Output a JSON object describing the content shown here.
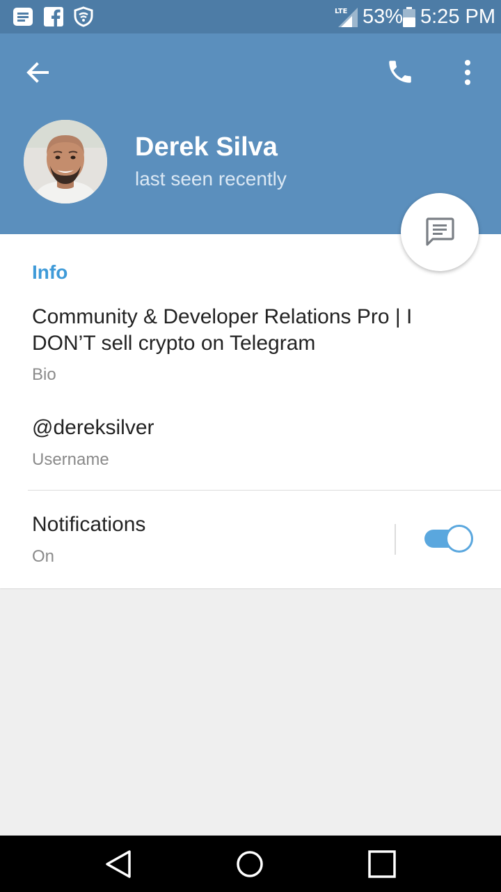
{
  "status_bar": {
    "icons": [
      "notes-icon",
      "facebook-icon",
      "vpn-shield-icon",
      "lte-signal-icon",
      "battery-icon"
    ],
    "network": "LTE",
    "battery": "53%",
    "time": "5:25 PM"
  },
  "header": {
    "back_icon": "arrow-left-icon",
    "call_icon": "phone-icon",
    "menu_icon": "more-vertical-icon",
    "name": "Derek Silva",
    "status": "last seen recently",
    "background_color": "#5b8fbd"
  },
  "fab": {
    "icon": "message-icon"
  },
  "info": {
    "section_title": "Info",
    "bio": "Community & Developer Relations Pro | I DON’T sell crypto on Telegram",
    "bio_label": "Bio",
    "username": "@dereksilver",
    "username_label": "Username"
  },
  "notifications": {
    "title": "Notifications",
    "status": "On",
    "enabled": true,
    "accent_color": "#5aa7de"
  },
  "nav_bar": {
    "icons": [
      "back-triangle-icon",
      "home-circle-icon",
      "recents-square-icon"
    ]
  }
}
